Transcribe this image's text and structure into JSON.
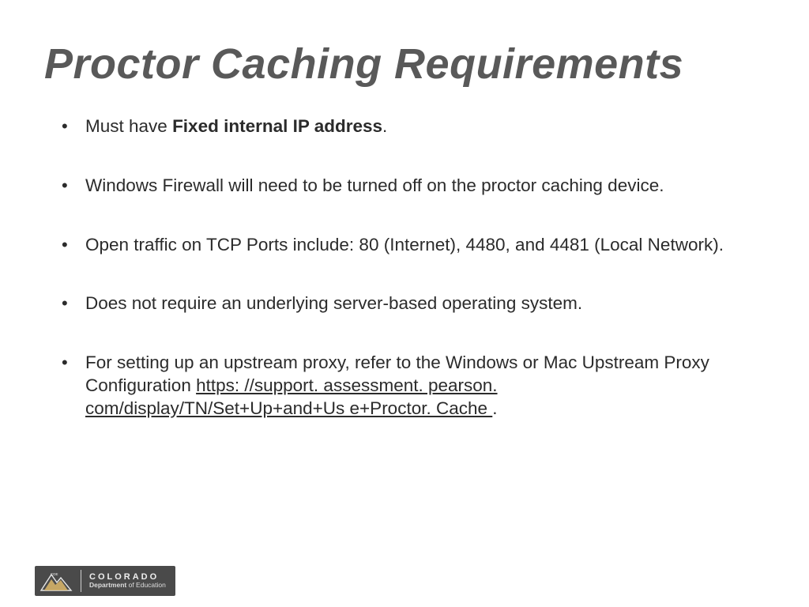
{
  "title": "Proctor Caching Requirements",
  "bullets": [
    {
      "pre": "Must have ",
      "bold": "Fixed internal IP address",
      "post": ". "
    },
    {
      "pre": "Windows Firewall will need to be turned off on the proctor caching device.",
      "bold": "",
      "post": ""
    },
    {
      "pre": "Open traffic on TCP Ports include: 80 (Internet), 4480,  and 4481 (Local Network).",
      "bold": "",
      "post": ""
    },
    {
      "pre": "Does not require an underlying server-based operating system.",
      "bold": "",
      "post": ""
    },
    {
      "pre": "For setting up an upstream proxy, refer to the Windows or Mac Upstream Proxy Configuration ",
      "bold": "",
      "link": "https: //support. assessment. pearson. com/display/TN/Set+Up+and+Us e+Proctor. Cache ",
      "post": "."
    }
  ],
  "footer": {
    "brand": "COLORADO",
    "dept_bold": "Department",
    "dept_rest": " of Education",
    "badge": "CDE"
  }
}
